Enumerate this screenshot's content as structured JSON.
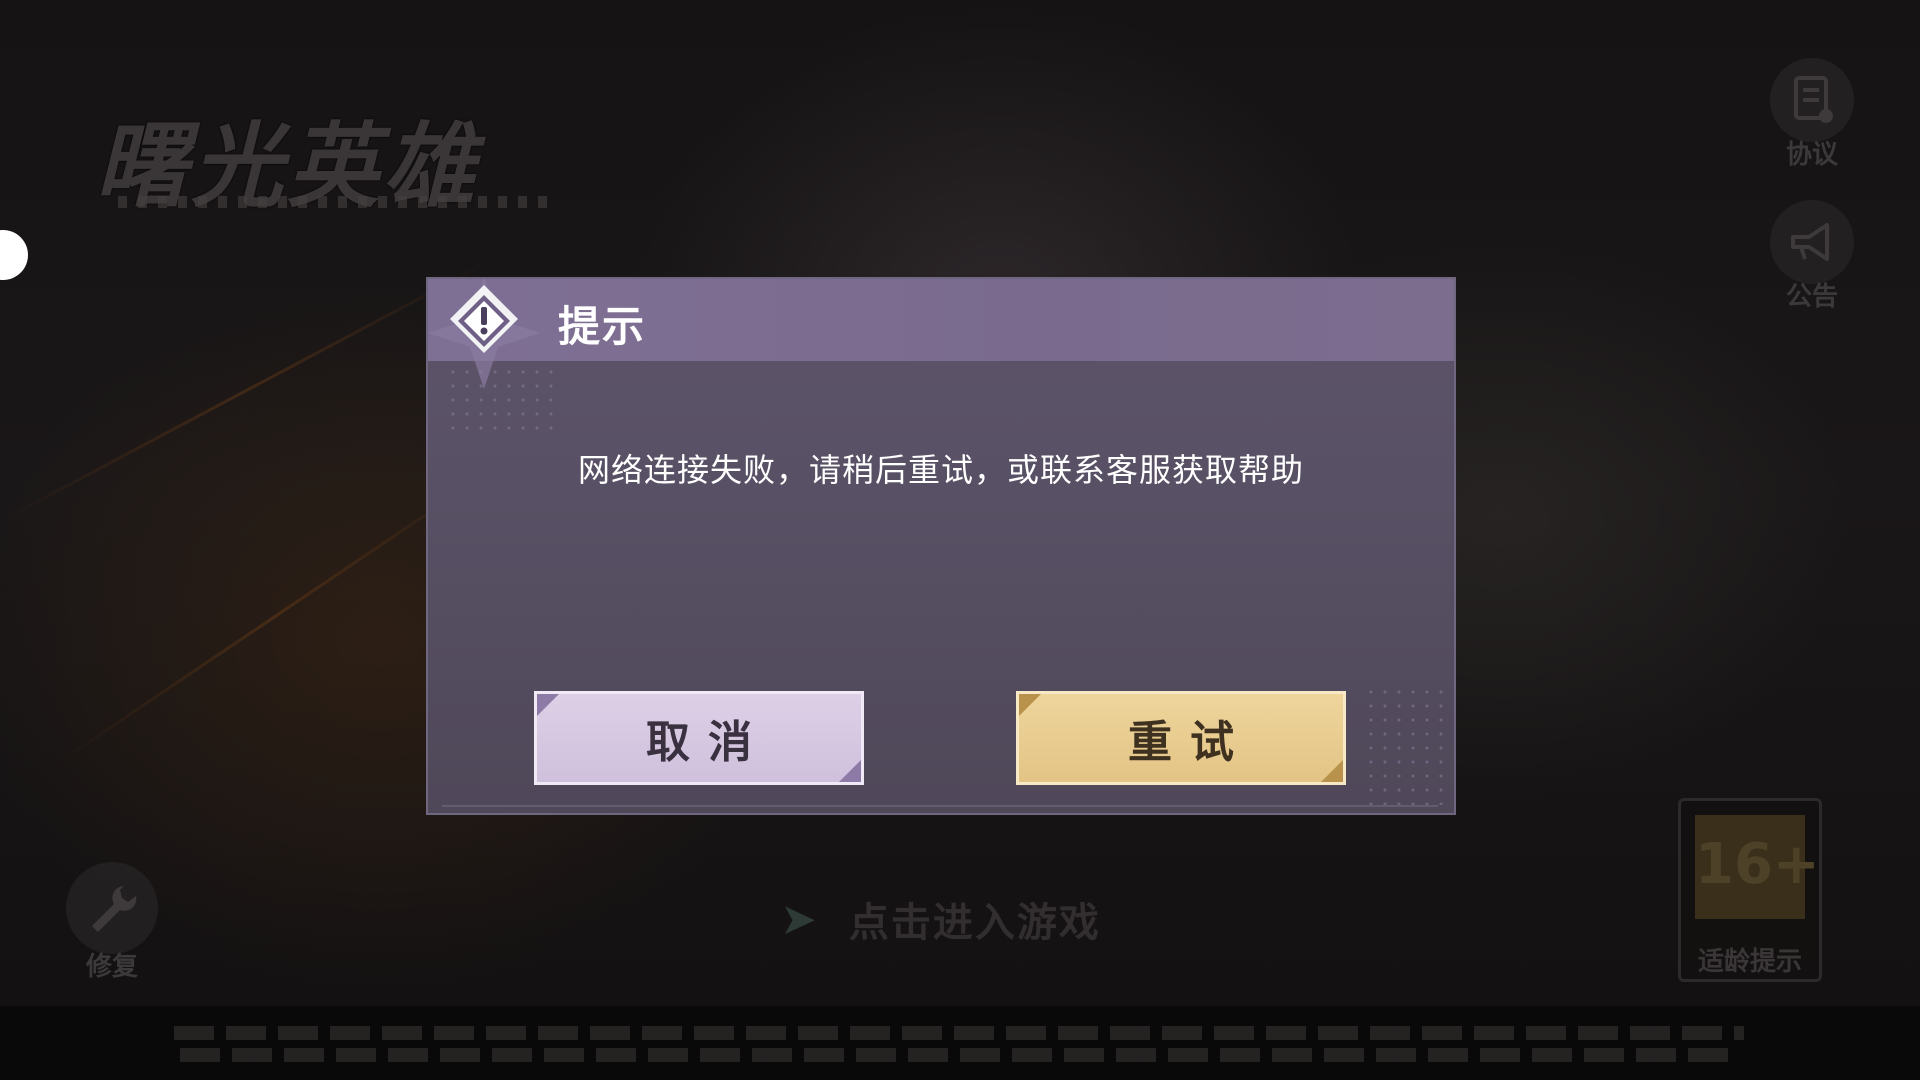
{
  "background": {
    "logo_text": "曙光英雄",
    "side_buttons": {
      "agreement_label": "协议",
      "notice_label": "公告"
    },
    "repair_label": "修复",
    "enter_game_label": "点击进入游戏",
    "age_rating": {
      "value": "16+",
      "label": "适龄提示"
    }
  },
  "dialog": {
    "title": "提示",
    "message": "网络连接失败，请稍后重试，或联系客服获取帮助",
    "cancel_label": "取消",
    "retry_label": "重试"
  },
  "icons": {
    "ornament": "warning-diamond-icon",
    "agreement": "document-icon",
    "notice": "megaphone-icon",
    "repair": "wrench-icon",
    "enter": "arrow-right-icon"
  },
  "colors": {
    "dialog_header": "#7e6f94",
    "dialog_body": "#5a5166",
    "cancel_button": "#d7c9e2",
    "retry_button": "#e9cd90"
  }
}
